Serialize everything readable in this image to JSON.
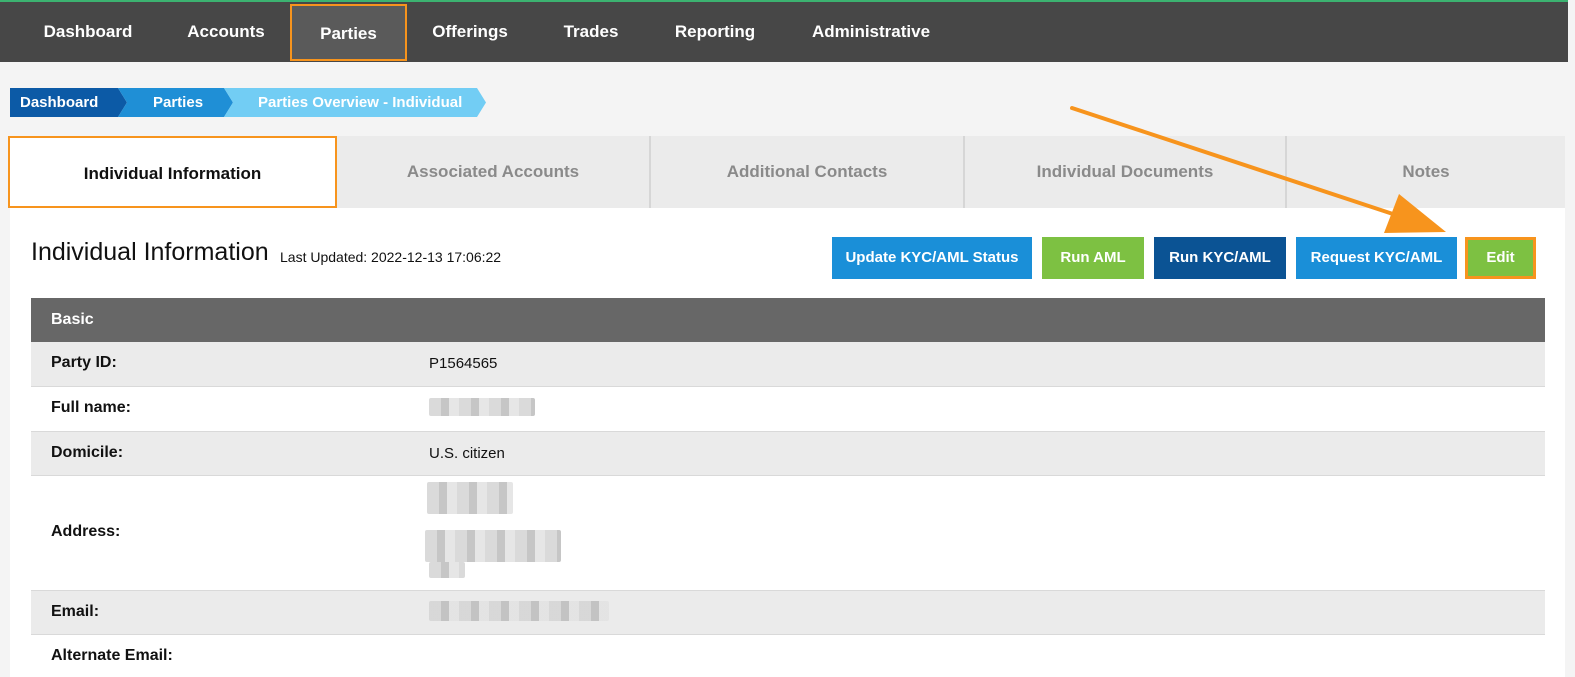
{
  "nav": {
    "items": [
      {
        "label": "Dashboard"
      },
      {
        "label": "Accounts"
      },
      {
        "label": "Parties"
      },
      {
        "label": "Offerings"
      },
      {
        "label": "Trades"
      },
      {
        "label": "Reporting"
      },
      {
        "label": "Administrative"
      }
    ],
    "active": "Parties"
  },
  "breadcrumb": [
    "Dashboard",
    "Parties",
    "Parties Overview - Individual"
  ],
  "tabs": [
    {
      "label": "Individual Information",
      "active": true
    },
    {
      "label": "Associated Accounts"
    },
    {
      "label": "Additional Contacts"
    },
    {
      "label": "Individual Documents"
    },
    {
      "label": "Notes"
    }
  ],
  "section": {
    "title": "Individual Information",
    "last_updated": "Last Updated: 2022-12-13 17:06:22"
  },
  "actions": {
    "update_kyc": "Update KYC/AML Status",
    "run_aml": "Run AML",
    "run_kyc": "Run KYC/AML",
    "request_kyc": "Request KYC/AML",
    "edit": "Edit"
  },
  "basic": {
    "header": "Basic",
    "rows": [
      {
        "label": "Party ID:",
        "value": "P1564565"
      },
      {
        "label": "Full name:",
        "value": ""
      },
      {
        "label": "Domicile:",
        "value": "U.S. citizen"
      },
      {
        "label": "Address:",
        "value": ""
      },
      {
        "label": "Email:",
        "value": ""
      },
      {
        "label": "Alternate Email:",
        "value": ""
      }
    ]
  },
  "colors": {
    "highlight": "#f7941d",
    "nav_bg": "#474747",
    "button_blue": "#1a8fd8",
    "button_green": "#7dc142",
    "button_navy": "#0b5394"
  }
}
